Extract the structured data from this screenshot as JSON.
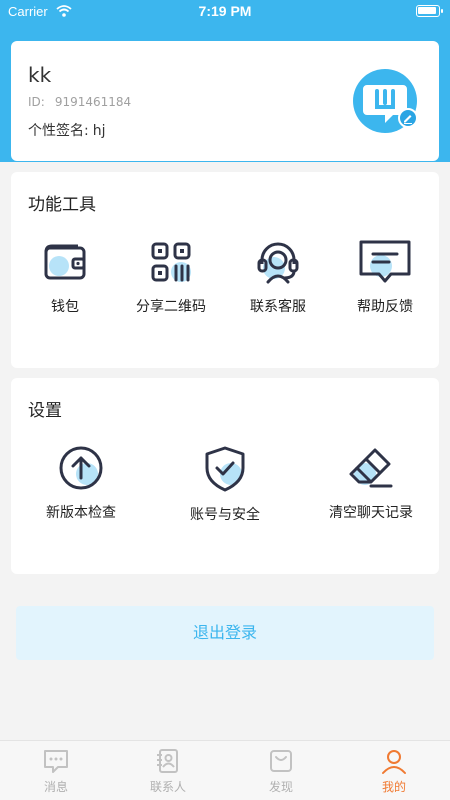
{
  "status_bar": {
    "carrier": "Carrier",
    "time": "7:19 PM"
  },
  "profile": {
    "name": "kk",
    "id_label": "ID:",
    "id_value": "9191461184",
    "signature_label": "个性签名:",
    "signature_value": "hj"
  },
  "tools": {
    "title": "功能工具",
    "items": [
      {
        "label": "钱包",
        "icon": "wallet-icon"
      },
      {
        "label": "分享二维码",
        "icon": "qr-code-icon"
      },
      {
        "label": "联系客服",
        "icon": "customer-service-icon"
      },
      {
        "label": "帮助反馈",
        "icon": "help-feedback-icon"
      }
    ]
  },
  "settings": {
    "title": "设置",
    "items": [
      {
        "label": "新版本检查",
        "icon": "update-check-icon"
      },
      {
        "label": "账号与安全",
        "icon": "shield-icon"
      },
      {
        "label": "清空聊天记录",
        "icon": "eraser-icon"
      }
    ]
  },
  "logout_label": "退出登录",
  "tabs": [
    {
      "label": "消息",
      "icon": "message-icon"
    },
    {
      "label": "联系人",
      "icon": "contacts-icon"
    },
    {
      "label": "发现",
      "icon": "discover-icon"
    },
    {
      "label": "我的",
      "icon": "profile-icon",
      "active": true
    }
  ],
  "colors": {
    "accent": "#3cb6ee",
    "active_tab": "#f07a32",
    "icon_dark": "#2e3347"
  }
}
